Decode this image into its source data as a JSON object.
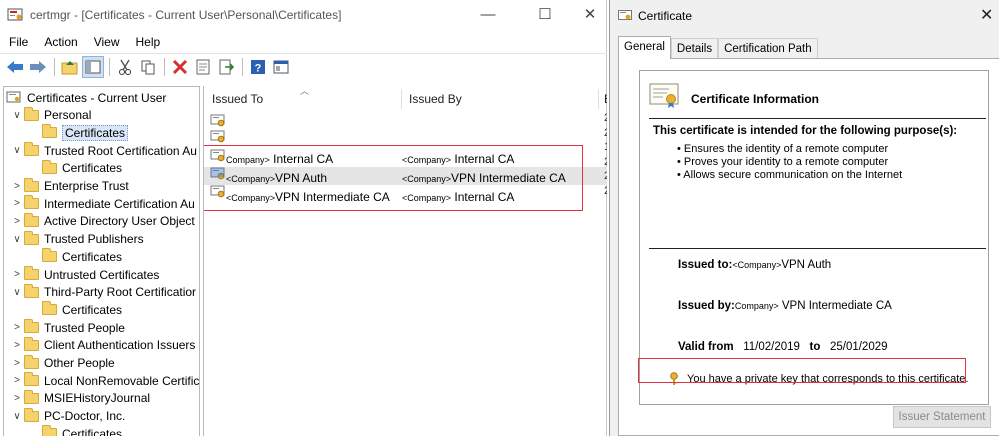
{
  "certmgr": {
    "title": "certmgr - [Certificates - Current User\\Personal\\Certificates]",
    "controls": {
      "minimize": "—",
      "maximize": "☐",
      "close": "✕"
    },
    "menu": [
      "File",
      "Action",
      "View",
      "Help"
    ],
    "tree": [
      {
        "label": "Certificates - Current User",
        "chevron": "",
        "type": "root"
      },
      {
        "label": "Personal",
        "chevron": "∨",
        "type": "folder"
      },
      {
        "label": "Certificates",
        "chevron": "",
        "type": "folder",
        "selected": true
      },
      {
        "label": "Trusted Root Certification Au",
        "chevron": "∨",
        "type": "folder"
      },
      {
        "label": "Certificates",
        "chevron": "",
        "type": "folder"
      },
      {
        "label": "Enterprise Trust",
        "chevron": ">",
        "type": "folder"
      },
      {
        "label": "Intermediate Certification Au",
        "chevron": ">",
        "type": "folder"
      },
      {
        "label": "Active Directory User Object",
        "chevron": ">",
        "type": "folder"
      },
      {
        "label": "Trusted Publishers",
        "chevron": "∨",
        "type": "folder"
      },
      {
        "label": "Certificates",
        "chevron": "",
        "type": "folder"
      },
      {
        "label": "Untrusted Certificates",
        "chevron": ">",
        "type": "folder"
      },
      {
        "label": "Third-Party Root Certificatior",
        "chevron": "∨",
        "type": "folder"
      },
      {
        "label": "Certificates",
        "chevron": "",
        "type": "folder"
      },
      {
        "label": "Trusted People",
        "chevron": ">",
        "type": "folder"
      },
      {
        "label": "Client Authentication Issuers",
        "chevron": ">",
        "type": "folder"
      },
      {
        "label": "Other People",
        "chevron": ">",
        "type": "folder"
      },
      {
        "label": "Local NonRemovable Certific",
        "chevron": ">",
        "type": "folder"
      },
      {
        "label": "MSIEHistoryJournal",
        "chevron": ">",
        "type": "folder"
      },
      {
        "label": "PC-Doctor, Inc.",
        "chevron": "∨",
        "type": "folder"
      },
      {
        "label": "Certificates",
        "chevron": "",
        "type": "folder"
      }
    ],
    "columns": {
      "issued_to": "Issued To",
      "issued_by": "Issued By",
      "expiry_fragment": "E"
    },
    "rows": [
      {
        "to_tag": "",
        "to_name": "",
        "by_tag": "",
        "by_name": "",
        "date": "2"
      },
      {
        "to_tag": "",
        "to_name": "",
        "by_tag": "",
        "by_name": "",
        "date": "2"
      },
      {
        "to_tag": "",
        "to_name": "",
        "by_tag": "",
        "by_name": "",
        "date": "1"
      },
      {
        "to_tag": "Company>",
        "to_name": " Internal CA",
        "by_tag": "<Company>",
        "by_name": " Internal CA",
        "date": "2"
      },
      {
        "to_tag": "<Company>",
        "to_name": "VPN Auth",
        "by_tag": "<Company>",
        "by_name": "VPN Intermediate CA",
        "date": "2"
      },
      {
        "to_tag": "<Company>",
        "to_name": "VPN Intermediate CA",
        "by_tag": "<Company>",
        "by_name": " Internal CA",
        "date": "2"
      }
    ]
  },
  "dialog": {
    "title": "Certificate",
    "close": "✕",
    "tabs": [
      "General",
      "Details",
      "Certification Path"
    ],
    "info_title": "Certificate Information",
    "purpose_heading": "This certificate is intended for the following purpose(s):",
    "purposes": [
      "• Ensures the identity of a remote computer",
      "• Proves your identity to a remote computer",
      "• Allows secure communication on the Internet"
    ],
    "issued_to_label": "Issued to:",
    "issued_to_tag": "<Company>",
    "issued_to_value": "VPN Auth",
    "issued_by_label": "Issued by:",
    "issued_by_tag": "Company>",
    "issued_by_value": " VPN Intermediate CA",
    "valid_from_label": "Valid from",
    "valid_from": "11/02/2019",
    "valid_to_label": "to",
    "valid_to": "25/01/2029",
    "private_key_note": "You have a private key that corresponds to this certificate.",
    "issuer_statement_button": "Issuer Statement"
  },
  "colors": {
    "highlight_red": "#e2333b",
    "folder_yellow": "#f5d36b",
    "selection_blue": "#d9e6f7",
    "disabled_gray": "#8a8a8a"
  },
  "icons": {
    "toolbar": [
      "back-arrow-icon",
      "forward-arrow-icon",
      "up-folder-icon",
      "show-hide-tree-icon",
      "cut-icon",
      "copy-icon",
      "delete-icon",
      "properties-icon",
      "export-icon",
      "help-icon",
      "console-icon"
    ]
  }
}
